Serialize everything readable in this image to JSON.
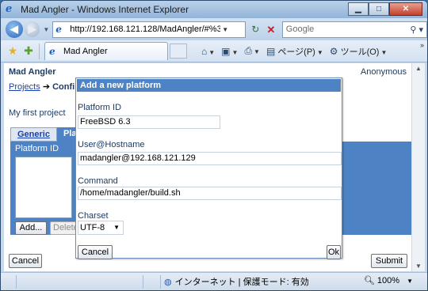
{
  "window": {
    "title": "Mad Angler - Windows Internet Explorer",
    "min_label": "▁",
    "max_label": "□",
    "close_label": "✕"
  },
  "nav": {
    "url": "http://192.168.121.128/MadAngler/#%3",
    "search_placeholder": "Google"
  },
  "tabbar": {
    "tab_label": "Mad Angler",
    "page_menu": "ページ(P)",
    "tools_menu": "ツール(O)"
  },
  "app": {
    "title": "Mad Angler",
    "user": "Anonymous",
    "breadcrumb_link": "Projects",
    "breadcrumb_sep": "➔",
    "breadcrumb_current": "Confi",
    "project_name": "My first project",
    "tabs": [
      "Generic",
      "Pla"
    ],
    "platform_id_label": "Platform ID",
    "add_button": "Add...",
    "delete_button": "Delete",
    "cancel_button": "Cancel",
    "submit_button": "Submit"
  },
  "dialog": {
    "title": "Add a new platform",
    "fields": {
      "platform_id": {
        "label": "Platform ID",
        "value": "FreeBSD 6.3"
      },
      "user_host": {
        "label": "User@Hostname",
        "value": "madangler@192.168.121.129"
      },
      "command": {
        "label": "Command",
        "value": "/home/madangler/build.sh"
      },
      "charset": {
        "label": "Charset",
        "value": "UTF-8"
      }
    },
    "cancel_button": "Cancel",
    "ok_button": "Ok"
  },
  "statusbar": {
    "zone": "インターネット | 保護モード: 有効",
    "zoom": "100%"
  },
  "colors": {
    "accent": "#4d83c4",
    "link": "#1a3fae",
    "heading": "#1c3c64"
  }
}
